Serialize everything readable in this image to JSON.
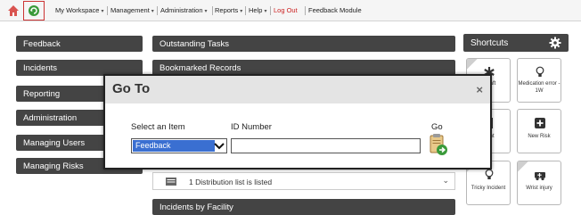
{
  "topbar": {
    "icons": [
      "home-icon",
      "refresh-icon"
    ],
    "menu": [
      {
        "label": "My Workspace",
        "has_dropdown": true
      },
      {
        "label": "Management",
        "has_dropdown": true
      },
      {
        "label": "Administration",
        "has_dropdown": true
      },
      {
        "label": "Reports",
        "has_dropdown": true
      },
      {
        "label": "Help",
        "has_dropdown": true
      },
      {
        "label": "Log Out",
        "has_dropdown": false
      },
      {
        "label": "Feedback Module",
        "has_dropdown": false
      }
    ],
    "caret": "▾"
  },
  "sidebar": {
    "items": [
      {
        "label": "Feedback"
      },
      {
        "label": "Incidents"
      },
      {
        "label": "Reporting"
      },
      {
        "label": "Administration"
      },
      {
        "label": "Managing Users"
      },
      {
        "label": "Managing Risks"
      }
    ]
  },
  "main": {
    "panels": [
      {
        "label": "Outstanding Tasks"
      },
      {
        "label": "Bookmarked Records"
      },
      {
        "label": "Incidents by Facility"
      }
    ],
    "distribution_row": "1 Distribution list is listed"
  },
  "shortcuts": {
    "title": "Shortcuts",
    "tiles": [
      {
        "label": "y draft",
        "icon": "asterisk-icon"
      },
      {
        "label": "Medication error - 1W",
        "icon": "lightbulb-icon"
      },
      {
        "label": "ident",
        "icon": "document-icon"
      },
      {
        "label": "New Risk",
        "icon": "plus-icon"
      },
      {
        "label": "Tricky Incident",
        "icon": "lightbulb-icon"
      },
      {
        "label": "Wrist injury",
        "icon": "ambulance-icon"
      }
    ]
  },
  "modal": {
    "title": "Go To",
    "close": "×",
    "select_label": "Select an Item",
    "id_label": "ID Number",
    "go_label": "Go",
    "selected_item": "Feedback",
    "id_value": ""
  },
  "colors": {
    "nav_bg": "#444444",
    "select_highlight": "#3a6fd1",
    "logout": "#cc2222",
    "refresh_box": "#cc3333",
    "go_icon_green": "#3a9a3a"
  }
}
